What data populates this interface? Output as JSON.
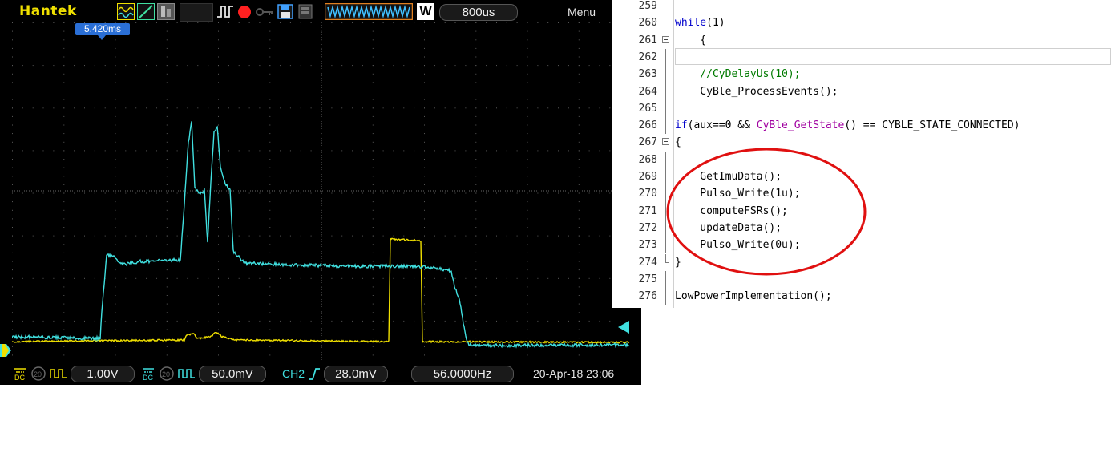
{
  "scope": {
    "brand": "Hantek",
    "menu_label": "Menu",
    "w_badge": "W",
    "timebase": "800us",
    "trigger_time": "5.420ms",
    "ch1_scale": "1.00V",
    "ch2_scale": "50.0mV",
    "trigger_source": "CH2",
    "trigger_level": "28.0mV",
    "frequency": "56.0000Hz",
    "datetime": "20-Apr-18 23:06",
    "coupling_label": "DC",
    "bw_label": "20",
    "colors": {
      "ch1_yellow": "#f0e000",
      "ch2_cyan": "#40e0e0",
      "grid": "#5a5a5a",
      "trigger_blue": "#2a6fd6",
      "stop_red": "#ff2020"
    }
  },
  "editor": {
    "lines": [
      {
        "num": "259",
        "segments": []
      },
      {
        "num": "260",
        "segments": [
          {
            "t": "while",
            "c": "kw"
          },
          {
            "t": "(1)",
            "c": ""
          }
        ]
      },
      {
        "num": "261",
        "segments": [
          {
            "t": "    {",
            "c": ""
          }
        ]
      },
      {
        "num": "262",
        "segments": []
      },
      {
        "num": "263",
        "segments": [
          {
            "t": "    //CyDelayUs(10);",
            "c": "cm"
          }
        ]
      },
      {
        "num": "264",
        "segments": [
          {
            "t": "    CyBle_ProcessEvents();",
            "c": ""
          }
        ]
      },
      {
        "num": "265",
        "segments": []
      },
      {
        "num": "266",
        "segments": [
          {
            "t": "if",
            "c": "kw"
          },
          {
            "t": "(aux==0 && ",
            "c": ""
          },
          {
            "t": "CyBle_GetState",
            "c": "fn"
          },
          {
            "t": "() == CYBLE_STATE_CONNECTED)",
            "c": ""
          }
        ]
      },
      {
        "num": "267",
        "segments": [
          {
            "t": "{",
            "c": ""
          }
        ]
      },
      {
        "num": "268",
        "segments": []
      },
      {
        "num": "269",
        "segments": [
          {
            "t": "    GetImuData();",
            "c": ""
          }
        ]
      },
      {
        "num": "270",
        "segments": [
          {
            "t": "    Pulso_Write(1u);",
            "c": ""
          }
        ]
      },
      {
        "num": "271",
        "segments": [
          {
            "t": "    computeFSRs();",
            "c": ""
          }
        ]
      },
      {
        "num": "272",
        "segments": [
          {
            "t": "    updateData();",
            "c": ""
          }
        ]
      },
      {
        "num": "273",
        "segments": [
          {
            "t": "    Pulso_Write(0u);",
            "c": ""
          }
        ]
      },
      {
        "num": "274",
        "segments": [
          {
            "t": "}",
            "c": ""
          }
        ]
      },
      {
        "num": "275",
        "segments": []
      },
      {
        "num": "276",
        "segments": [
          {
            "t": "LowPowerImplementation();",
            "c": ""
          }
        ]
      }
    ]
  },
  "annotation_color": "#e01010"
}
